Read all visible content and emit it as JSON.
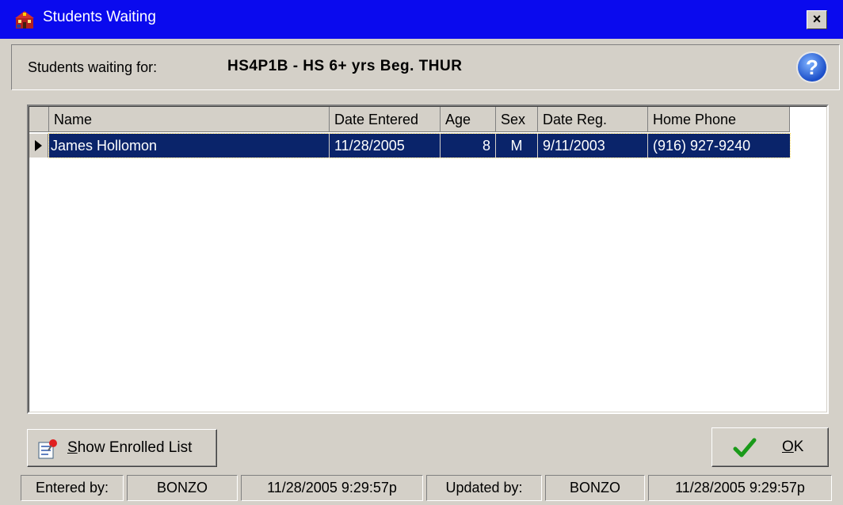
{
  "window": {
    "title": "Students Waiting",
    "close_label": "×"
  },
  "header": {
    "label": "Students waiting for:",
    "class_value": "HS4P1B - HS 6+ yrs Beg. THUR",
    "help_glyph": "?"
  },
  "grid": {
    "columns": [
      "Name",
      "Date Entered",
      "Age",
      "Sex",
      "Date Reg.",
      "Home Phone"
    ],
    "rows": [
      {
        "name": "James Hollomon",
        "date_entered": "11/28/2005",
        "age": "8",
        "sex": "M",
        "date_reg": "9/11/2003",
        "home_phone": "(916) 927-9240"
      }
    ],
    "selection_color": "#0a246a"
  },
  "buttons": {
    "show_enrolled_pre": "S",
    "show_enrolled_rest": "how Enrolled List",
    "ok_pre": "O",
    "ok_rest": "K"
  },
  "status": {
    "entered_label": "Entered by:",
    "entered_user": "BONZO",
    "entered_time": "11/28/2005 9:29:57p",
    "updated_label": "Updated by:",
    "updated_user": "BONZO",
    "updated_time": "11/28/2005 9:29:57p"
  },
  "colors": {
    "titlebar": "#0a0aee",
    "face": "#d4d0c8",
    "ok_check": "#1a9a1a"
  }
}
